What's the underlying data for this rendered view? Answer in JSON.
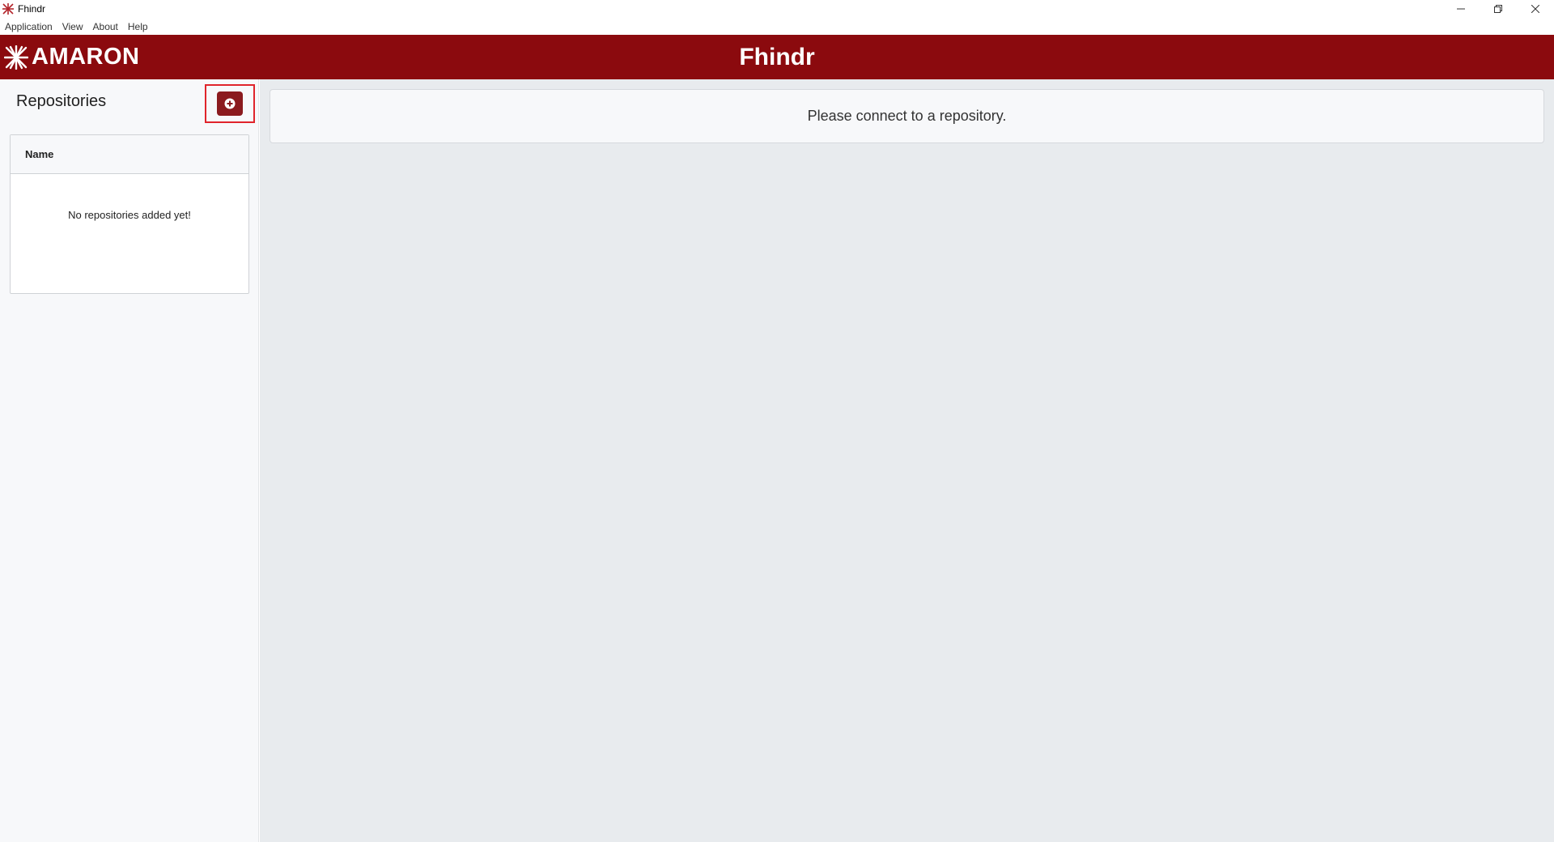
{
  "window": {
    "title": "Fhindr"
  },
  "menu": {
    "items": [
      "Application",
      "View",
      "About",
      "Help"
    ]
  },
  "header": {
    "logo_text": "AMARON",
    "app_title": "Fhindr"
  },
  "sidebar": {
    "title": "Repositories",
    "add_button_icon": "plus-circle-icon",
    "table": {
      "columns": [
        "Name"
      ],
      "empty_message": "No repositories added yet!"
    }
  },
  "main": {
    "notice": "Please connect to a repository."
  },
  "colors": {
    "brand_red": "#8b0a0e",
    "highlight_border": "#e0242b",
    "sidebar_bg": "#f7f8fa",
    "main_bg": "#e8ebee"
  }
}
